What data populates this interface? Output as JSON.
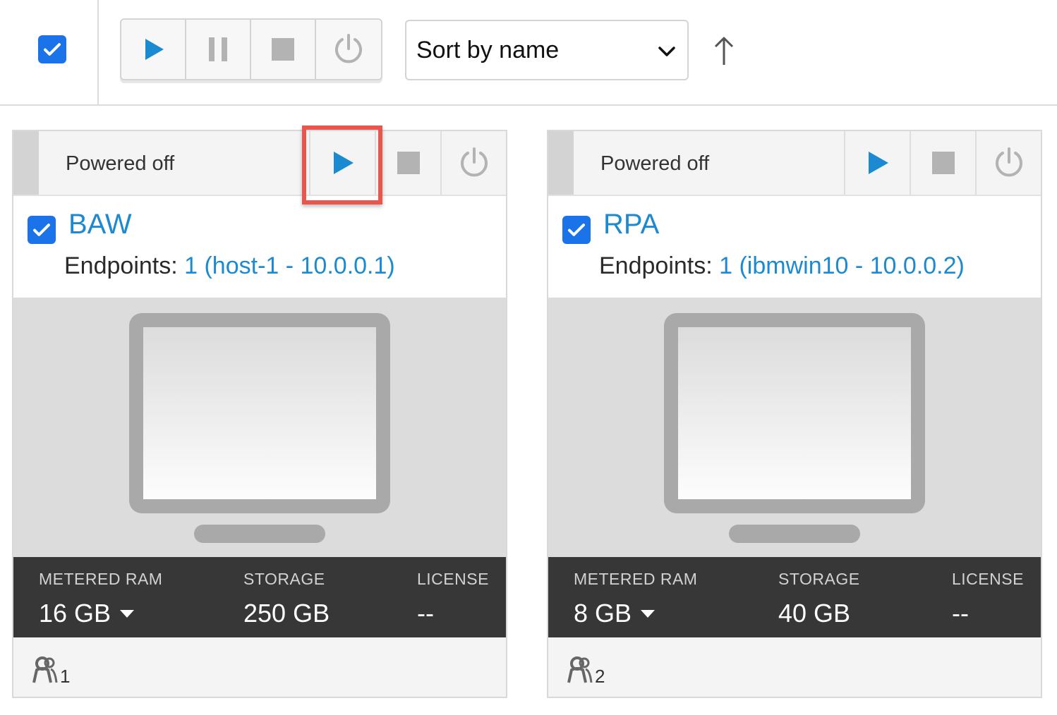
{
  "toolbar": {
    "select_all_checked": true,
    "buttons": [
      {
        "name": "play",
        "icon": "play-icon"
      },
      {
        "name": "pause",
        "icon": "pause-icon"
      },
      {
        "name": "stop",
        "icon": "stop-icon"
      },
      {
        "name": "power",
        "icon": "power-icon"
      }
    ],
    "sort": {
      "selected": "Sort by name",
      "dropdown_icon": "chevron-down-icon"
    },
    "sort_direction_icon": "arrow-up-icon"
  },
  "vms": [
    {
      "status": "Powered off",
      "name": "BAW",
      "checked": true,
      "endpoints_label": "Endpoints:",
      "endpoints_link": "1 (host-1 - 10.0.0.1)",
      "stats": {
        "ram_label": "METERED RAM",
        "ram_value": "16 GB",
        "storage_label": "STORAGE",
        "storage_value": "250 GB",
        "license_label": "LICENSE",
        "license_value": "--"
      },
      "footer_icon": "users-icon",
      "footer_count": "1"
    },
    {
      "status": "Powered off",
      "name": "RPA",
      "checked": true,
      "endpoints_label": "Endpoints:",
      "endpoints_link": "1 (ibmwin10 - 10.0.0.2)",
      "stats": {
        "ram_label": "METERED RAM",
        "ram_value": "8 GB",
        "storage_label": "STORAGE",
        "storage_value": "40 GB",
        "license_label": "LICENSE",
        "license_value": "--"
      },
      "footer_icon": "users-icon",
      "footer_count": "2"
    }
  ],
  "colors": {
    "accent": "#1c8ad0",
    "checkbox": "#1a73e8",
    "highlight": "#e8574e",
    "stats_bar": "#373737"
  }
}
